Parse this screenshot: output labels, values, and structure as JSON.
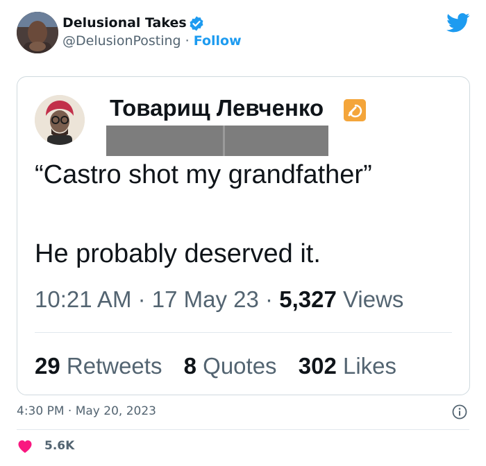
{
  "tweet": {
    "author_name": "Delusional Takes",
    "handle": "@DelusionPosting",
    "separator": "·",
    "follow_label": "Follow",
    "timestamp": "4:30 PM · May 20, 2023",
    "likes": "5.6K"
  },
  "quoted": {
    "author_name": "Товарищ Левченко",
    "line1": "“Castro shot my grandfather”",
    "line2": "He probably deserved it.",
    "time": "10:21 AM",
    "date": "17 May 23",
    "dot": "·",
    "views_count": "5,327",
    "views_label": "Views",
    "retweets_count": "29",
    "retweets_label": "Retweets",
    "quotes_count": "8",
    "quotes_label": "Quotes",
    "likes_count": "302",
    "likes_label": "Likes"
  },
  "colors": {
    "accent": "#1d9bf0",
    "like": "#f91880",
    "muted_text": "#536471",
    "border": "#cfd9de"
  },
  "icons": {
    "verified": "verified-badge-icon",
    "platform": "twitter-bird-icon",
    "info": "info-icon",
    "like": "heart-icon",
    "emoji": "hammer-and-sickle-icon"
  }
}
